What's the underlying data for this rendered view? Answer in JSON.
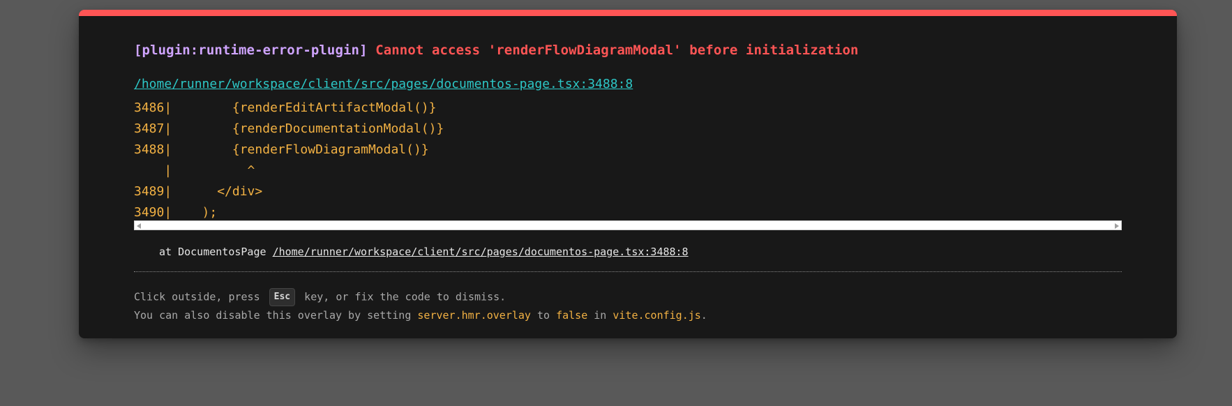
{
  "error": {
    "plugin": "[plugin:runtime-error-plugin]",
    "message": "Cannot access 'renderFlowDiagramModal' before initialization",
    "file": "/home/runner/workspace/client/src/pages/documentos-page.tsx:3488:8"
  },
  "frame": [
    "3486|        {renderEditArtifactModal()}",
    "3487|        {renderDocumentationModal()}",
    "3488|        {renderFlowDiagramModal()}",
    "    |          ^",
    "3489|      </div>",
    "3490|    );"
  ],
  "stack": {
    "prefix": "at DocumentosPage ",
    "file": "/home/runner/workspace/client/src/pages/documentos-page.tsx:3488:8"
  },
  "tip": {
    "line1_before": "Click outside, press ",
    "key": "Esc",
    "line1_after": " key, or fix the code to dismiss.",
    "line2_before": "You can also disable this overlay by setting ",
    "setting": "server.hmr.overlay",
    "line2_mid1": " to ",
    "value": "false",
    "line2_mid2": " in ",
    "config": "vite.config.js",
    "line2_end": "."
  },
  "colors": {
    "accent_bar": "#ff5555",
    "plugin": "#cfa4ff",
    "error": "#ff5555",
    "link": "#2dc7c6",
    "code": "#f2b143"
  }
}
